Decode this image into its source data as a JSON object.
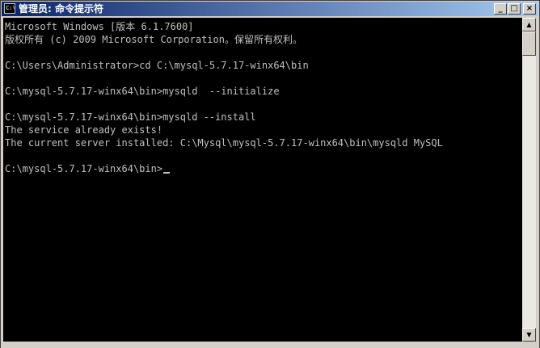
{
  "window": {
    "title": "管理员: 命令提示符",
    "icon_text": "C:\\",
    "buttons": {
      "minimize": "_",
      "maximize": "□",
      "close": "×"
    }
  },
  "console": {
    "lines": [
      "Microsoft Windows [版本 6.1.7600]",
      "版权所有 (c) 2009 Microsoft Corporation。保留所有权利。",
      "",
      "C:\\Users\\Administrator>cd C:\\mysql-5.7.17-winx64\\bin",
      "",
      "C:\\mysql-5.7.17-winx64\\bin>mysqld  --initialize",
      "",
      "C:\\mysql-5.7.17-winx64\\bin>mysqld --install",
      "The service already exists!",
      "The current server installed: C:\\Mysql\\mysql-5.7.17-winx64\\bin\\mysqld MySQL",
      "",
      "C:\\mysql-5.7.17-winx64\\bin>"
    ]
  },
  "scrollbar": {
    "up_arrow": "▲",
    "down_arrow": "▼"
  },
  "colors": {
    "console_bg": "#000000",
    "console_text": "#c0c0c0",
    "titlebar_start": "#0a246a",
    "titlebar_end": "#a6caf0"
  }
}
